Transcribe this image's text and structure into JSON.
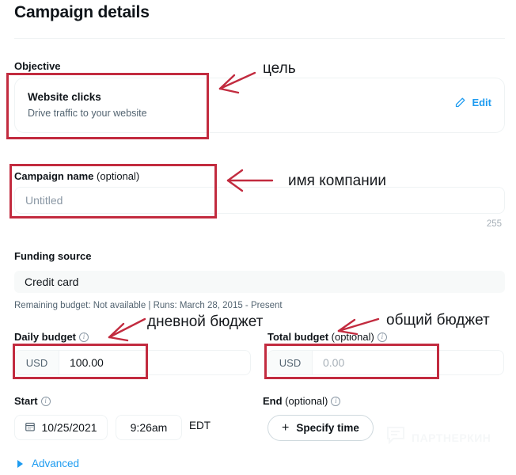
{
  "page": {
    "title": "Campaign details"
  },
  "objective": {
    "label": "Objective",
    "card_title": "Website clicks",
    "card_subtitle": "Drive traffic to your website",
    "edit_label": "Edit",
    "edit_icon": "pencil-icon",
    "accent_color": "#1d9bf0"
  },
  "campaign_name": {
    "label": "Campaign name",
    "optional": " (optional)",
    "value": "",
    "placeholder": "Untitled",
    "char_count": "255"
  },
  "funding_source": {
    "label": "Funding source",
    "value": "Credit card",
    "note": "Remaining budget: Not available | Runs: March 28, 2015 - Present"
  },
  "daily_budget": {
    "label": "Daily budget",
    "info_icon": "info-icon",
    "currency": "USD",
    "value": "100.00",
    "placeholder": "0.00"
  },
  "total_budget": {
    "label": "Total budget",
    "optional": " (optional)",
    "info_icon": "info-icon",
    "currency": "USD",
    "value": "",
    "placeholder": "0.00"
  },
  "start": {
    "label": "Start",
    "info_icon": "info-icon",
    "date_icon": "calendar-icon",
    "date": "10/25/2021",
    "time": "9:26am",
    "timezone": "EDT"
  },
  "end": {
    "label": "End",
    "optional": " (optional)",
    "info_icon": "info-icon",
    "specify_label": "Specify time",
    "plus_icon": "plus-icon"
  },
  "advanced": {
    "label": "Advanced",
    "caret_icon": "caret-right-icon"
  },
  "annotations": {
    "color": "#c22b3f",
    "labels": [
      {
        "text": "цель"
      },
      {
        "text": "имя компании"
      },
      {
        "text": "дневной бюджет"
      },
      {
        "text": "общий бюджет"
      }
    ]
  },
  "watermark": {
    "text": "ПАРТНЕРКИН",
    "icon": "speech-bubble-icon"
  }
}
